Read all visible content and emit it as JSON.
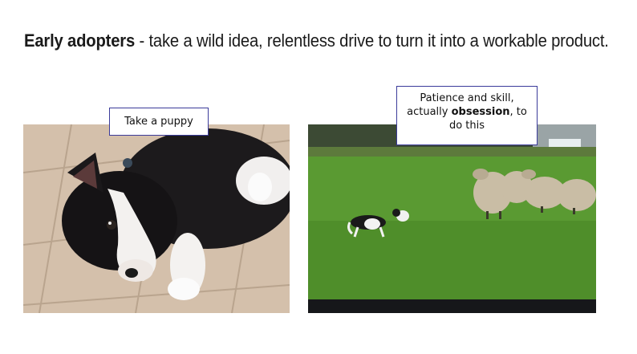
{
  "headline": {
    "bold": "Early adopters",
    "rest": " - take a wild idea, relentless drive to turn it into a workable product."
  },
  "captions": {
    "puppy": "Take a puppy",
    "field_line1": "Patience and skill,",
    "field_line2_pre": "actually ",
    "field_line2_bold": "obsession",
    "field_line2_post": ", to",
    "field_line3": "do this"
  },
  "photos": {
    "puppy": "puppy-lying-on-tile-floor",
    "field": "sheepdog-herding-sheep-in-field"
  }
}
